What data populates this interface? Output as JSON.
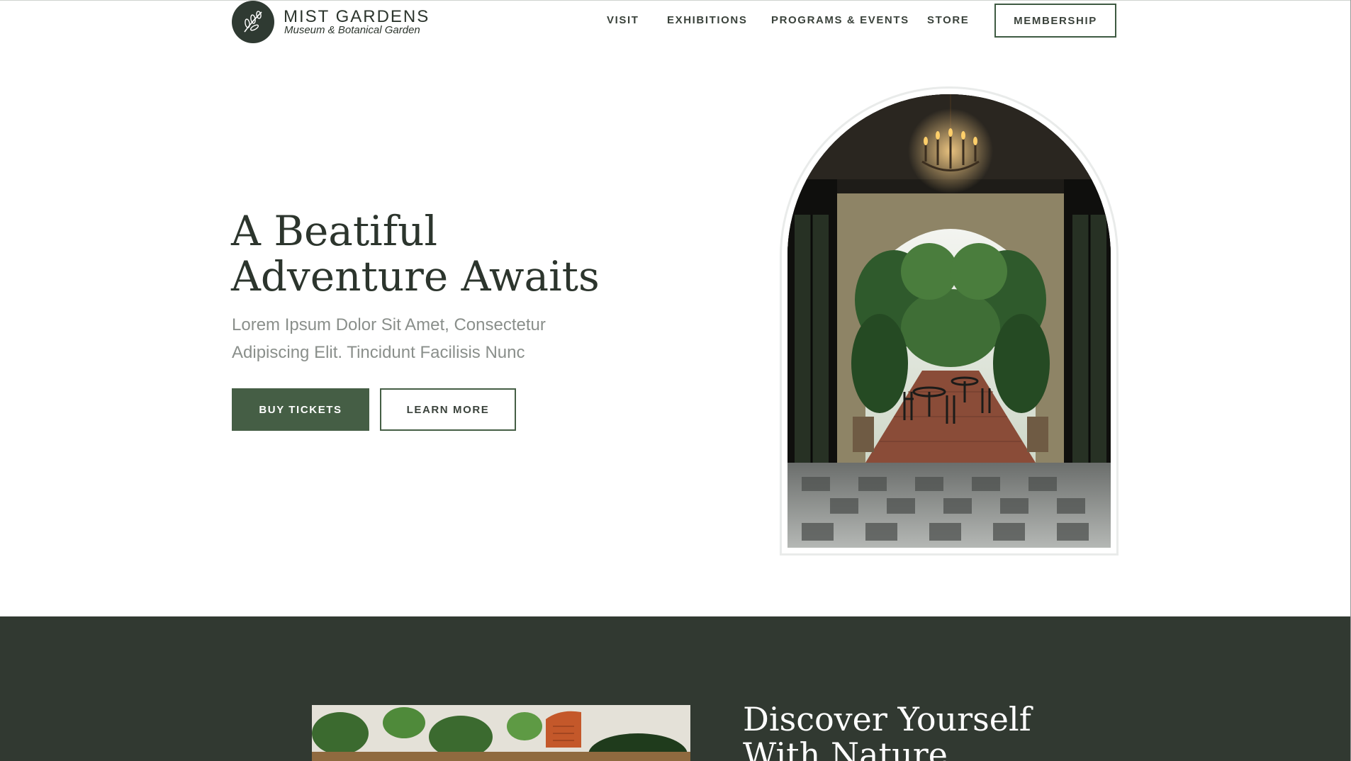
{
  "brand": {
    "name": "MIST GARDENS",
    "tagline": "Museum & Botanical Garden"
  },
  "nav": {
    "items": [
      "VISIT",
      "EXHIBITIONS",
      "PROGRAMS & EVENTS",
      "STORE"
    ],
    "membership_label": "MEMBERSHIP"
  },
  "hero": {
    "title_line1": "A Beatiful",
    "title_line2": "Adventure Awaits",
    "subtitle_line1": "Lorem Ipsum Dolor Sit Amet, Consectetur",
    "subtitle_line2": "Adipiscing Elit. Tincidunt Facilisis Nunc",
    "buy_label": "BUY TICKETS",
    "learn_label": "LEARN MORE"
  },
  "section2": {
    "title_line1": "Discover Yourself",
    "title_line2": "With Nature"
  },
  "colors": {
    "primary_green": "#455e45",
    "dark_bg": "#313931",
    "text_dark": "#2c352d"
  }
}
